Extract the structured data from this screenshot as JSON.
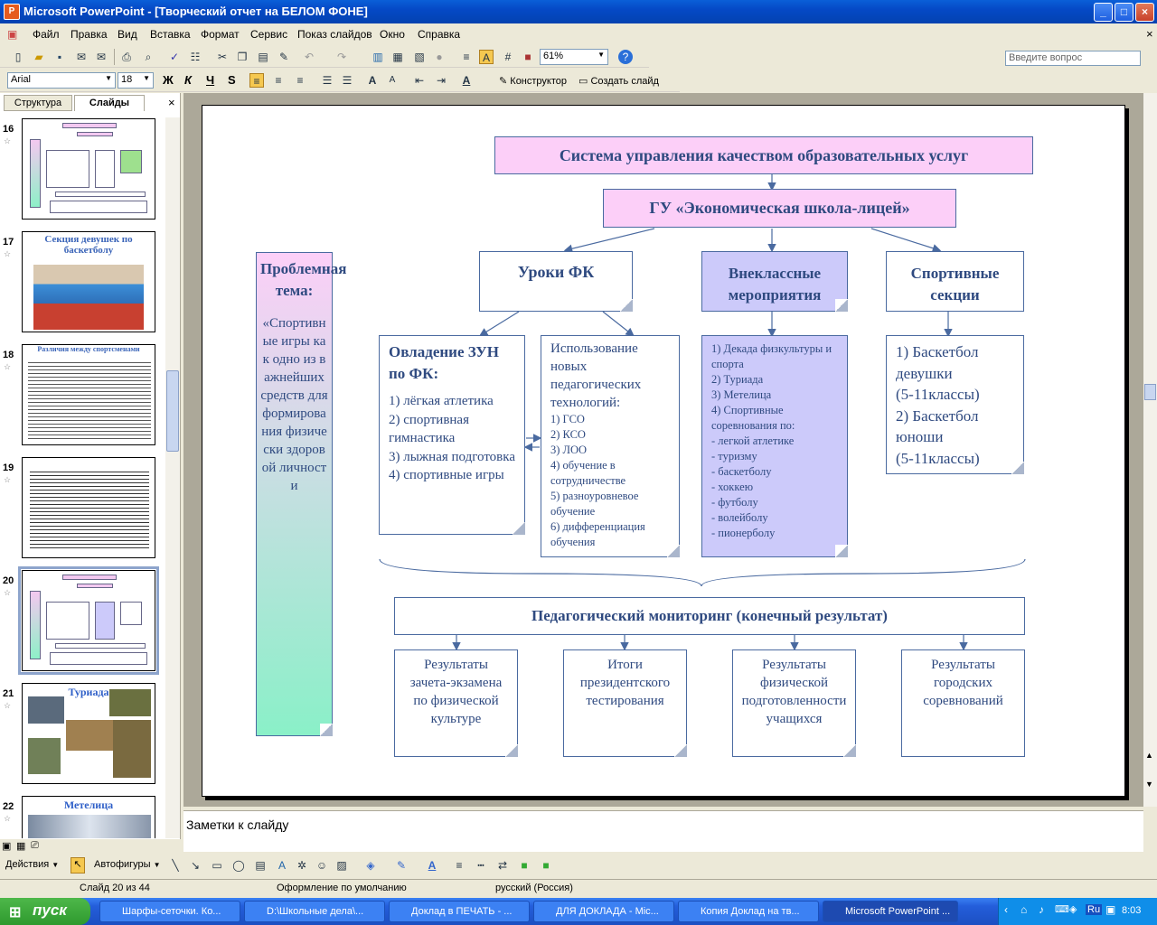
{
  "window": {
    "title": "Microsoft PowerPoint - [Творческий отчет на БЕЛОМ ФОНЕ]"
  },
  "menu": [
    "Файл",
    "Правка",
    "Вид",
    "Вставка",
    "Формат",
    "Сервис",
    "Показ слайдов",
    "Окно",
    "Справка"
  ],
  "ask_placeholder": "Введите вопрос",
  "toolbar": {
    "zoom": "61%",
    "font": "Arial",
    "size": "18",
    "bold": "Ж",
    "italic": "К",
    "underline": "Ч",
    "shadow": "S",
    "designer": "Конструктор",
    "new_slide": "Создать слайд"
  },
  "tabs": {
    "outline": "Структура",
    "slides": "Слайды"
  },
  "thumbs": [
    {
      "num": "16",
      "title": ""
    },
    {
      "num": "17",
      "title": "Секция девушек по баскетболу"
    },
    {
      "num": "18",
      "title": "Различия между спортсменами"
    },
    {
      "num": "19",
      "title": ""
    },
    {
      "num": "20",
      "title": ""
    },
    {
      "num": "21",
      "title": "Туриада"
    },
    {
      "num": "22",
      "title": "Метелица"
    }
  ],
  "slide": {
    "top": "Система управления качеством образовательных услуг",
    "school": "ГУ «Экономическая школа-лицей»",
    "left_title": "Проблемная тема:",
    "left_text": "«Спортивные игры как одно из важнейших средств для формирования физически здоровой личности",
    "col1": "Уроки ФК",
    "col2": "Внеклассные мероприятия",
    "col3": "Спортивные секции",
    "zun_title": "Овладение ЗУН по ФК:",
    "zun_items": [
      "1) лёгкая атлетика",
      "2) спортивная гимнастика",
      "3) лыжная подготовка",
      "4) спортивные игры"
    ],
    "tech_title": "Использование новых педагогических технологий:",
    "tech_items": [
      "1) ГСО",
      "2) КСО",
      "3) ЛОО",
      "4) обучение в сотрудничестве",
      "5) разноуровневое обучение",
      "6) дифференциация обучения"
    ],
    "events": [
      "1) Декада физкультуры и спорта",
      "2) Туриада",
      "3) Метелица",
      "4) Спортивные соревнования по:",
      "- легкой атлетике",
      "- туризму",
      "- баскетболу",
      "- хоккею",
      "- футболу",
      "- волейболу",
      "- пионерболу"
    ],
    "sections": [
      "1) Баскетбол девушки",
      "(5-11классы)",
      "2) Баскетбол юноши",
      "(5-11классы)"
    ],
    "monitoring": "Педагогический мониторинг (конечный результат)",
    "results": [
      "Результаты зачета-экзамена по физической культуре",
      "Итоги президентского тестирования",
      "Результаты физической подготовленности учащихся",
      "Результаты городских соревнований"
    ]
  },
  "notes": "Заметки к слайду",
  "drawbar": {
    "actions": "Действия",
    "autoshapes": "Автофигуры"
  },
  "status": {
    "slide": "Слайд 20 из 44",
    "design": "Оформление по умолчанию",
    "lang": "русский (Россия)"
  },
  "taskbar": {
    "start": "пуск",
    "tasks": [
      "Шарфы-сеточки. Ко...",
      "D:\\Школьные дела\\...",
      "Доклад в ПЕЧАТЬ - ...",
      "ДЛЯ ДОКЛАДА - Mic...",
      "Копия Доклад на тв...",
      "Microsoft PowerPoint ..."
    ],
    "time": "8:03",
    "lang": "Ru"
  }
}
